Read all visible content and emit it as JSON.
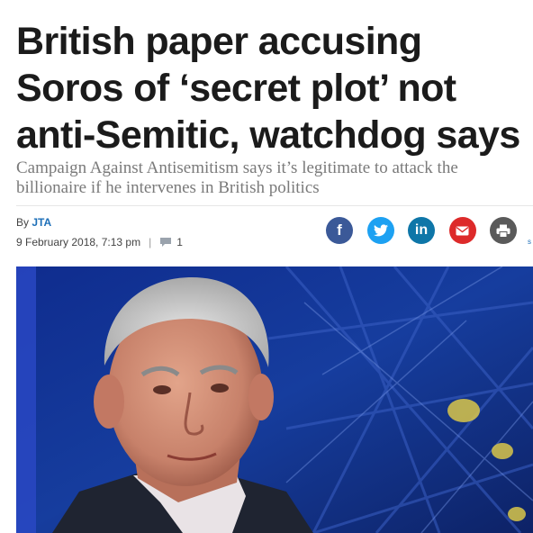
{
  "article": {
    "headline": "British paper accusing Soros of ‘secret plot’ not anti-Semitic, watchdog says",
    "subheadline": "Campaign Against Antisemitism says it’s legitimate to attack the billionaire if he intervenes in British politics",
    "byline_prefix": "By",
    "author": "JTA",
    "date": "9 February 2018, 7:13 pm",
    "separator": "|",
    "comment_count": "1"
  },
  "share": {
    "facebook_glyph": "f",
    "linkedin_glyph": "in",
    "more_label": "s",
    "icons": [
      "facebook-icon",
      "twitter-icon",
      "linkedin-icon",
      "email-icon",
      "print-icon"
    ],
    "colors": {
      "facebook": "#3b5998",
      "twitter": "#1da1f2",
      "linkedin": "#0e76a8",
      "email": "#dd2a2a",
      "print": "#5a5a5a"
    }
  },
  "colors": {
    "headline": "#1b1b1b",
    "subheadline": "#7a7a7a",
    "author_link": "#1d6fb8",
    "photo_background": "#14307a"
  }
}
